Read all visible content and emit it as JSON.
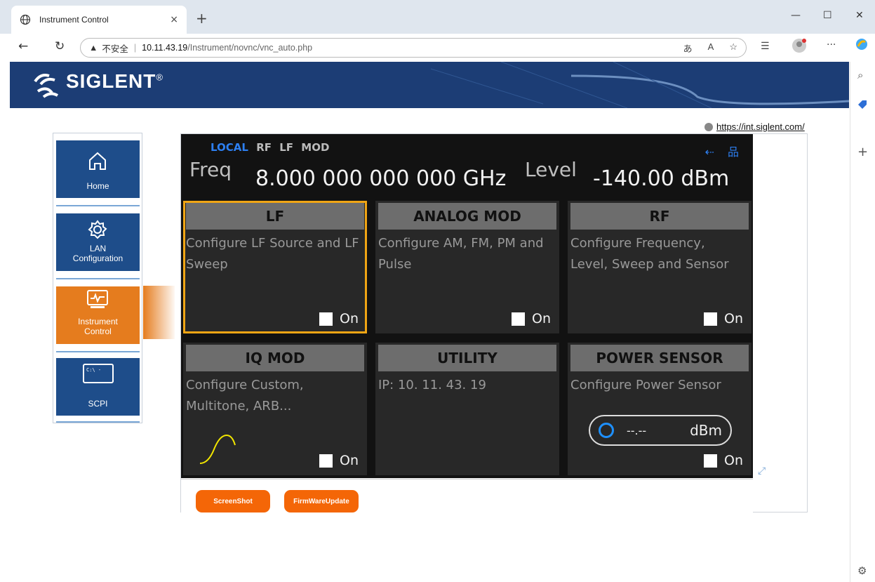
{
  "browser": {
    "tab_title": "Instrument Control",
    "tab_close": "×",
    "new_tab": "+",
    "address": {
      "warning": "▲",
      "insecure_label": "不安全",
      "separator": "|",
      "host": "10.11.43.19",
      "path": "/Instrument/novnc/vnc_auto.php"
    },
    "icons": [
      "globe-icon",
      "back-icon",
      "refresh-icon",
      "read-aloud-icon",
      "favorite-icon",
      "favorites-icon",
      "profile-icon",
      "more-icon",
      "copilot-icon",
      "search-icon",
      "add-icon",
      "settings-icon"
    ]
  },
  "site": {
    "brand": "SIGLENT",
    "brand_mark": "®",
    "link": "https://int.siglent.com/",
    "nav": [
      {
        "label": "Home",
        "icon": "home-icon",
        "active": false
      },
      {
        "label_line1": "LAN",
        "label_line2": "Configuration",
        "icon": "gear-icon",
        "active": false
      },
      {
        "label_line1": "Instrument",
        "label_line2": "Control",
        "icon": "monitor-icon",
        "active": true
      },
      {
        "label": "SCPI",
        "icon": "terminal-icon",
        "terminal_text": "C:\\ -",
        "active": false
      }
    ]
  },
  "instrument": {
    "status": {
      "local": "LOCAL",
      "rf": "RF",
      "lf": "LF",
      "mod": "MOD"
    },
    "freq_label": "Freq",
    "freq_value": "8.000 000 000 000 GHz",
    "level_label": "Level",
    "level_value": "-140.00  dBm",
    "tiles": [
      {
        "title": "LF",
        "desc": "Configure LF Source and LF Sweep",
        "on": "On"
      },
      {
        "title": "ANALOG MOD",
        "desc": "Configure AM, FM, PM and Pulse",
        "on": "On"
      },
      {
        "title": "RF",
        "desc": "Configure Frequency, Level, Sweep and Sensor",
        "on": "On"
      },
      {
        "title": "IQ MOD",
        "desc": "Configure Custom, Multitone, ARB...",
        "on": "On"
      },
      {
        "title": "UTILITY",
        "desc": "IP: 10. 11. 43. 19"
      },
      {
        "title": "POWER SENSOR",
        "desc": "Configure Power Sensor",
        "reading": "--.--",
        "unit": "dBm",
        "on": "On"
      }
    ]
  },
  "buttons": {
    "screenshot": "ScreenShot",
    "firmware": "FirmWareUpdate"
  },
  "colors": {
    "accent_orange": "#f46607",
    "nav_blue": "#1e4d8a",
    "nav_active": "#e57c1e",
    "highlight": "#f0a514",
    "status_blue": "#2d7ff0"
  }
}
